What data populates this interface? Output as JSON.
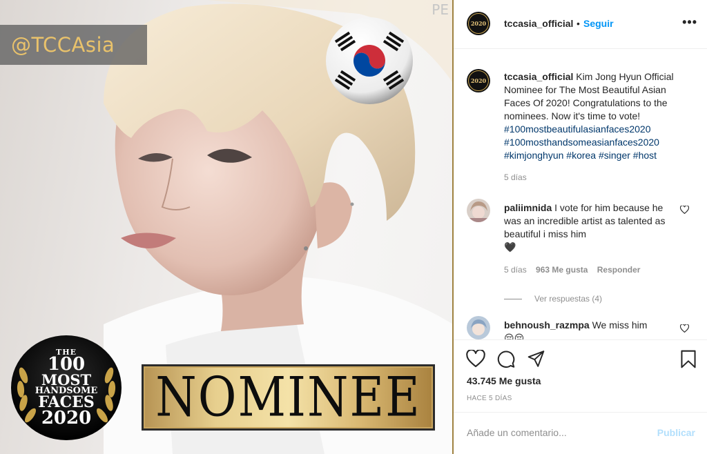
{
  "post_image": {
    "watermark": "@TCCAsia",
    "corner_mark": "PE",
    "award": {
      "line1": "THE",
      "line2": "100",
      "line3": "MOST",
      "line4": "HANDSOME",
      "line5": "FACES",
      "line6": "2020"
    },
    "nominee_label": "NOMINEE"
  },
  "header": {
    "username": "tccasia_official",
    "separator": "•",
    "follow_label": "Seguir",
    "more_icon": "more-options-icon",
    "more_glyph": "•••"
  },
  "avatar_text": "2020",
  "caption": {
    "username": "tccasia_official",
    "text": "Kim Jong Hyun Official Nominee for The Most Beautiful Asian Faces Of 2020!  Congratulations to the nominees. Now it's time to vote!",
    "hashtags": [
      "#100mostbeautifulasianfaces2020",
      "#100mosthandsomeasianfaces2020",
      "#kimjonghyun",
      "#korea",
      "#singer",
      "#host"
    ],
    "time": "5 días"
  },
  "comments": [
    {
      "username": "paliimnida",
      "text": "I vote for him because he was an incredible artist as talented as beautiful i miss him",
      "emoji": "🖤",
      "time": "5 días",
      "likes": "963 Me gusta",
      "reply_label": "Responder",
      "view_replies": "Ver respuestas (4)"
    },
    {
      "username": "behnoush_razmpa",
      "text": "We miss him",
      "emoji": "😔😔"
    }
  ],
  "actions": {
    "like_icon": "heart-icon",
    "comment_icon": "comment-icon",
    "share_icon": "share-icon",
    "save_icon": "bookmark-icon",
    "likes_count": "43.745 Me gusta",
    "posted_ago": "HACE 5 DÍAS"
  },
  "comment_box": {
    "placeholder": "Añade un comentario...",
    "publish_label": "Publicar"
  },
  "colors": {
    "link_blue": "#0095f6",
    "hashtag": "#00376b",
    "publish_disabled": "#b2dffc",
    "gold": "#e3c278",
    "divider": "#9f8240"
  }
}
